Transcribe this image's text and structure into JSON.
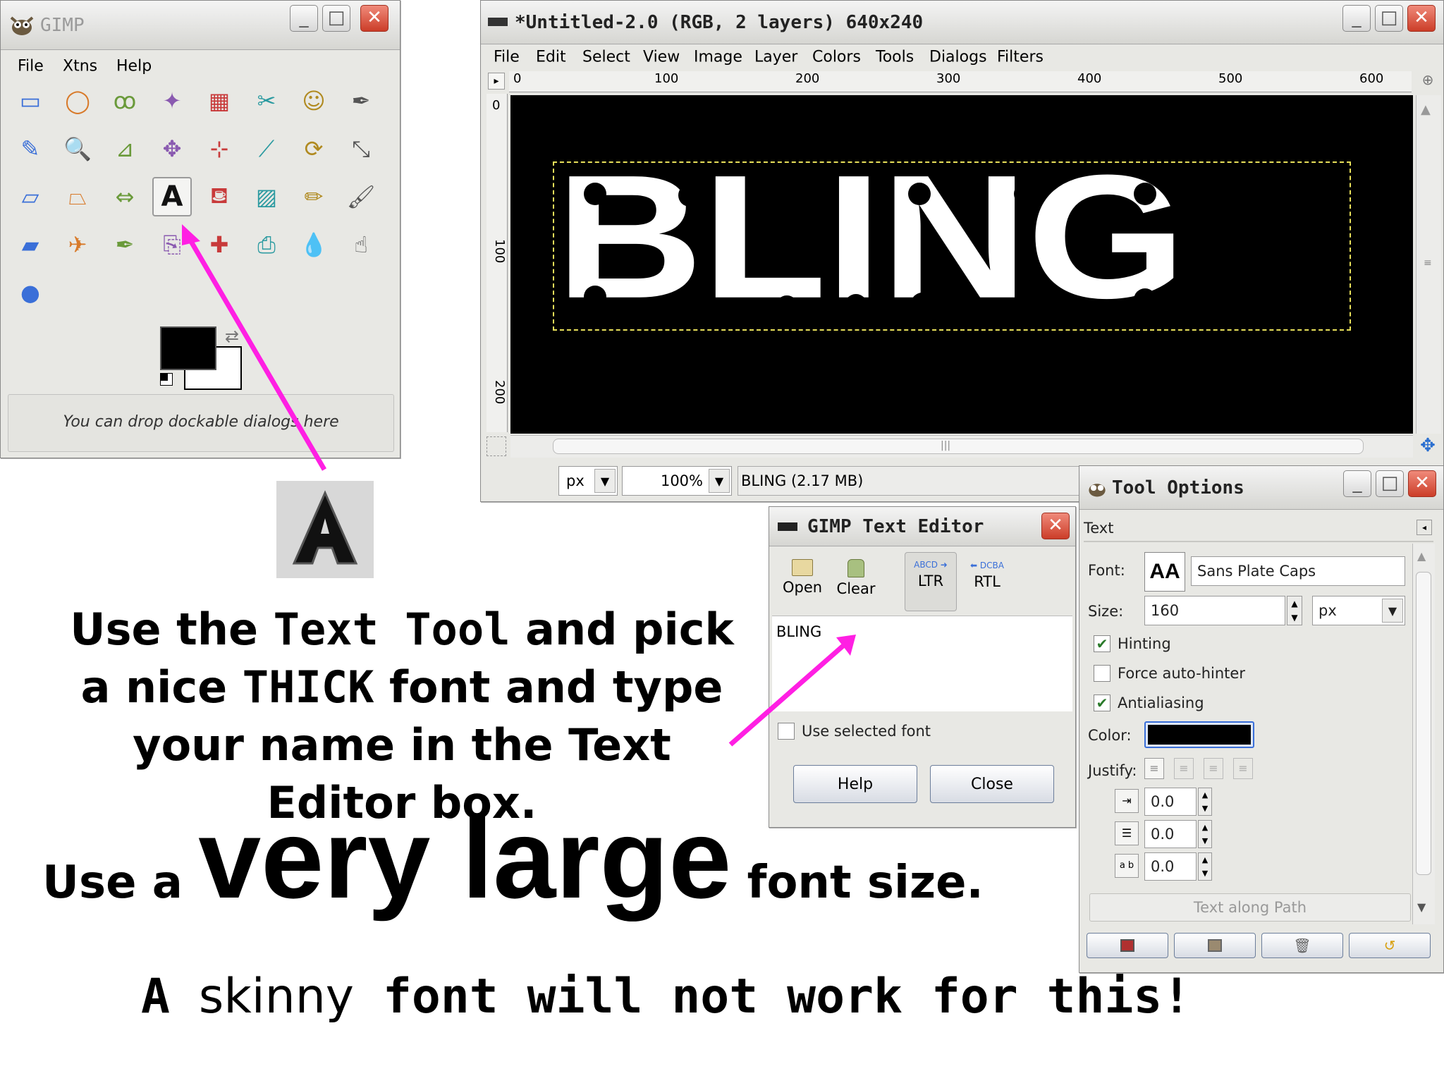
{
  "toolbox": {
    "title": "GIMP",
    "menu": [
      "File",
      "Xtns",
      "Help"
    ],
    "tools": [
      "rect-select",
      "ellipse-select",
      "free-select",
      "fuzzy-select",
      "color-select",
      "scissors",
      "foreground-select",
      "paths",
      "color-picker",
      "zoom",
      "measure",
      "move",
      "align",
      "crop",
      "rotate",
      "scale",
      "shear",
      "perspective",
      "flip",
      "text",
      "bucket-fill",
      "blend",
      "pencil",
      "paintbrush",
      "eraser",
      "airbrush",
      "ink",
      "clone",
      "heal",
      "perspective-clone",
      "convolve",
      "smudge",
      "dodge-burn"
    ],
    "dock_hint": "You can drop dockable dialogs here",
    "fg_color": "#000000",
    "bg_color": "#ffffff"
  },
  "image_window": {
    "title": "*Untitled-2.0 (RGB, 2 layers) 640x240",
    "menu": [
      "File",
      "Edit",
      "Select",
      "View",
      "Image",
      "Layer",
      "Colors",
      "Tools",
      "Dialogs",
      "Filters"
    ],
    "ruler_labels": [
      "0",
      "100",
      "200",
      "300",
      "400",
      "500",
      "600"
    ],
    "vruler_labels": [
      "0",
      "100",
      "200"
    ],
    "canvas_text": "BLING",
    "unit": "px",
    "zoom": "100%",
    "status": "BLING (2.17 MB)"
  },
  "text_editor": {
    "title": "GIMP Text Editor",
    "buttons": {
      "open": "Open",
      "clear": "Clear",
      "ltr": "LTR",
      "rtl": "RTL"
    },
    "content": "BLING",
    "use_selected_font": "Use selected font",
    "help": "Help",
    "close": "Close"
  },
  "tool_options": {
    "title": "Tool Options",
    "section": "Text",
    "font_label": "Font:",
    "font_preview": "AA",
    "font_value": "Sans Plate Caps",
    "size_label": "Size:",
    "size_value": "160",
    "size_unit": "px",
    "hinting": "Hinting",
    "force_autohinter": "Force auto-hinter",
    "antialiasing": "Antialiasing",
    "color_label": "Color:",
    "color_value": "#000000",
    "justify_label": "Justify:",
    "indent": "0.0",
    "line_spacing": "0.0",
    "letter_spacing": "0.0",
    "text_along_path": "Text along Path"
  },
  "instructions": {
    "p1_a": "Use the ",
    "p1_b": "Text Tool",
    "p1_c": " and pick a nice ",
    "p1_d": "THICK",
    "p1_e": " font and type your name in the Text Editor box.",
    "p2_a": "Use a ",
    "p2_b": "very large",
    "p2_c": " font size.",
    "p3_a": "A ",
    "p3_b": "skinny",
    "p3_c": " font will not work for this!"
  },
  "colors": {
    "accent_arrow": "#ff1fe3",
    "canvas_bg": "#000000",
    "selection": "#e8e05a"
  }
}
